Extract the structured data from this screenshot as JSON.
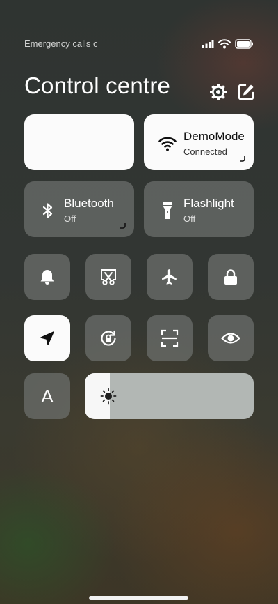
{
  "status_bar": {
    "text": "Emergency calls only"
  },
  "header": {
    "title": "Control centre"
  },
  "tiles": {
    "wifi": {
      "label": "DemoMode",
      "sub": "Connected",
      "active": true
    },
    "bluetooth": {
      "label": "Bluetooth",
      "sub": "Off"
    },
    "flashlight": {
      "label": "Flashlight",
      "sub": "Off"
    }
  },
  "toggles": [
    {
      "name": "bell",
      "icon": "bell-icon",
      "active": false
    },
    {
      "name": "screenshot",
      "icon": "scissors-screenshot-icon",
      "active": false
    },
    {
      "name": "airplane-mode",
      "icon": "airplane-icon",
      "active": false
    },
    {
      "name": "lock-screen",
      "icon": "lock-icon",
      "active": false
    },
    {
      "name": "location",
      "icon": "location-arrow-icon",
      "active": true
    },
    {
      "name": "rotation-lock",
      "icon": "rotation-lock-icon",
      "active": false
    },
    {
      "name": "scanner",
      "icon": "scan-frame-icon",
      "active": false
    },
    {
      "name": "reading-mode",
      "icon": "eye-icon",
      "active": false
    },
    {
      "name": "auto-brightness",
      "icon": "letter-a-icon",
      "active": false
    }
  ],
  "auto_brightness": {
    "label": "A"
  },
  "brightness": {
    "level_percent": 15,
    "icon": "sun-icon"
  },
  "colors": {
    "tile": "#6e706e",
    "active_tile": "#fbfbfb",
    "slider_track": "#b2b7b4",
    "slider_fill": "#f7f7f7"
  }
}
